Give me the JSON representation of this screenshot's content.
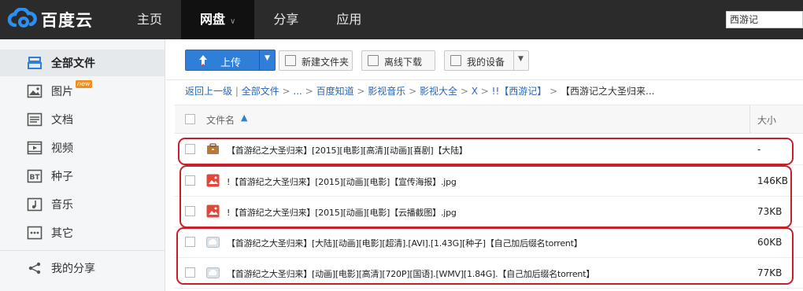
{
  "brand": {
    "name": "百度云"
  },
  "nav": [
    {
      "label": "主页"
    },
    {
      "label": "网盘",
      "active": true
    },
    {
      "label": "分享"
    },
    {
      "label": "应用"
    }
  ],
  "search": {
    "value": "西游记"
  },
  "sidebar": {
    "items": [
      {
        "label": "全部文件",
        "icon": "all-files-icon",
        "active": true
      },
      {
        "label": "图片",
        "icon": "image-icon",
        "badge": "new"
      },
      {
        "label": "文档",
        "icon": "document-icon"
      },
      {
        "label": "视频",
        "icon": "video-icon"
      },
      {
        "label": "种子",
        "icon": "bt-icon"
      },
      {
        "label": "音乐",
        "icon": "music-icon"
      },
      {
        "label": "其它",
        "icon": "other-icon"
      },
      {
        "label": "我的分享",
        "icon": "share-icon"
      }
    ]
  },
  "toolbar": {
    "upload": "上传",
    "new_folder": "新建文件夹",
    "offline_download": "离线下载",
    "my_devices": "我的设备"
  },
  "breadcrumb": {
    "back": "返回上一级",
    "items": [
      "全部文件",
      "...",
      "百度知道",
      "影视音乐",
      "影视大全",
      "X",
      "!!【西游记】"
    ],
    "current": "【西游记之大圣归来..."
  },
  "table": {
    "columns": {
      "name": "文件名",
      "size": "大小"
    },
    "rows": [
      {
        "name": "【首游纪之大圣归来】[2015][电影][高清][动画][喜剧]【大陆】",
        "size": "-",
        "icon": "folder-icon"
      },
      {
        "name": "!【首游纪之大圣归来】[2015][动画][电影]【宣传海报】.jpg",
        "size": "146KB",
        "icon": "image-file-icon"
      },
      {
        "name": "!【首游纪之大圣归来】[2015][动画][电影]【云播截图】.jpg",
        "size": "73KB",
        "icon": "image-file-icon"
      },
      {
        "name": "【首游纪之大圣归来】[大陆][动画][电影][超清].[AVI].[1.43G][种子]【自己加后缀名torrent】",
        "size": "60KB",
        "icon": "torrent-file-icon"
      },
      {
        "name": "【首游纪之大圣归来】[动画][电影][高清][720P][国语].[WMV][1.84G].【自己加后缀名torrent】",
        "size": "77KB",
        "icon": "torrent-file-icon"
      }
    ]
  },
  "colors": {
    "accent": "#2f7fd9",
    "highlight": "#c8202a",
    "topbar": "#2b2b2b"
  }
}
